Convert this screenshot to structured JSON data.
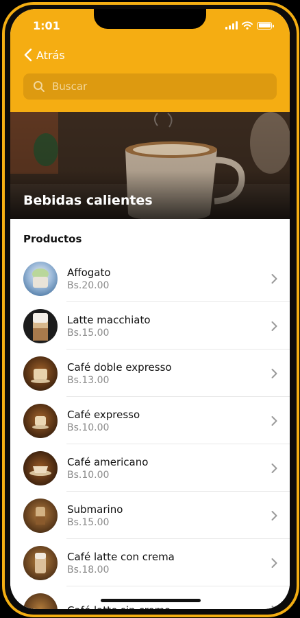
{
  "status_bar": {
    "time": "1:01"
  },
  "nav": {
    "back_label": "Atrás"
  },
  "search": {
    "placeholder": "Buscar",
    "value": ""
  },
  "banner": {
    "title": "Bebidas calientes"
  },
  "products": {
    "section_title": "Productos",
    "items": [
      {
        "name": "Affogato",
        "price": "Bs.20.00"
      },
      {
        "name": "Latte macchiato",
        "price": "Bs.15.00"
      },
      {
        "name": "Café doble expresso",
        "price": "Bs.13.00"
      },
      {
        "name": "Café expresso",
        "price": "Bs.10.00"
      },
      {
        "name": "Café americano",
        "price": "Bs.10.00"
      },
      {
        "name": "Submarino",
        "price": "Bs.15.00"
      },
      {
        "name": "Café latte con crema",
        "price": "Bs.18.00"
      },
      {
        "name": "Café latte sin crema",
        "price": ""
      }
    ]
  },
  "colors": {
    "accent": "#f5ad12",
    "search_bg": "#dd9a10",
    "frame": "#f3ae13"
  }
}
